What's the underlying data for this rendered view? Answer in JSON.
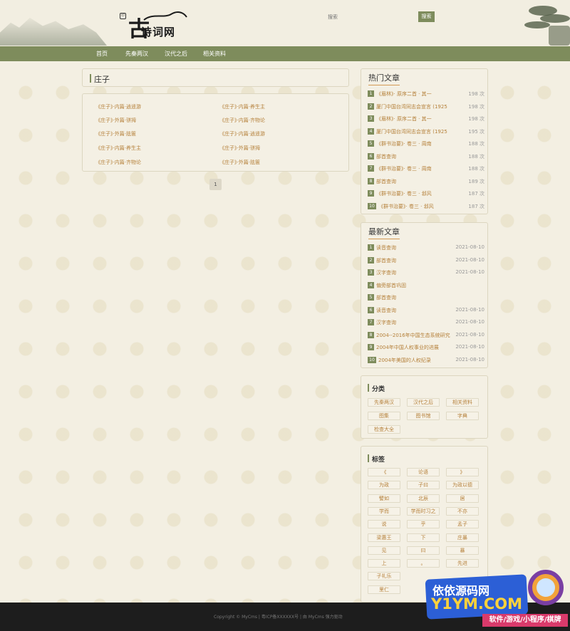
{
  "header": {
    "logo_big": "古",
    "logo_small": "诗词网",
    "seal": "印",
    "search_placeholder": "搜索",
    "search_button": "搜索"
  },
  "nav": [
    "首页",
    "先秦两汉",
    "汉代之后",
    "相关资料"
  ],
  "main": {
    "title": "庄子",
    "items": [
      "《庄子》·内篇·逍遥游",
      "《庄子》·内篇·养生主",
      "《庄子》·外篇·骈拇",
      "《庄子》·内篇·齐物论",
      "《庄子》·外篇·胠箧",
      "《庄子》·内篇·逍遥游",
      "《庄子》·内篇·养生主",
      "《庄子》·外篇·骈拇",
      "《庄子》·内篇·齐物论",
      "《庄子》·外篇·胠箧"
    ],
    "page": "1"
  },
  "hot": {
    "title": "热门文章",
    "rows": [
      {
        "n": "1",
        "t": "《眉林》· 原序二首 · 其一",
        "v": "198 次"
      },
      {
        "n": "2",
        "t": "厦门中国台湾同志会宣言 (1925",
        "v": "198 次"
      },
      {
        "n": "3",
        "t": "《眉林》· 原序二首 · 其一",
        "v": "198 次"
      },
      {
        "n": "4",
        "t": "厦门中国台湾同志会宣言 (1925",
        "v": "195 次"
      },
      {
        "n": "5",
        "t": "《群书治要》· 卷三 · 周南",
        "v": "188 次"
      },
      {
        "n": "6",
        "t": "部首查询",
        "v": "188 次"
      },
      {
        "n": "7",
        "t": "《群书治要》· 卷三 · 周南",
        "v": "188 次"
      },
      {
        "n": "8",
        "t": "部首查询",
        "v": "189 次"
      },
      {
        "n": "9",
        "t": "《群书治要》· 卷三 · 邶风",
        "v": "187 次"
      },
      {
        "n": "10",
        "t": "《群书治要》· 卷三 · 邶风",
        "v": "187 次"
      }
    ]
  },
  "latest": {
    "title": "最新文章",
    "rows": [
      {
        "n": "1",
        "t": "读音查询",
        "v": "2021-08-10"
      },
      {
        "n": "2",
        "t": "部首查询",
        "v": "2021-08-10"
      },
      {
        "n": "3",
        "t": "汉字查询",
        "v": "2021-08-10"
      },
      {
        "n": "4",
        "t": "偏旁部首巩固",
        "v": ""
      },
      {
        "n": "5",
        "t": "部首查询",
        "v": ""
      },
      {
        "n": "6",
        "t": "读音查询",
        "v": "2021-08-10"
      },
      {
        "n": "7",
        "t": "汉字查询",
        "v": "2021-08-10"
      },
      {
        "n": "8",
        "t": "2004--2016年中国生态系统研究",
        "v": "2021-08-10"
      },
      {
        "n": "9",
        "t": "2004年中国人权事业的进展",
        "v": "2021-08-10"
      },
      {
        "n": "10",
        "t": "2004年美国的人权纪录",
        "v": "2021-08-10"
      }
    ]
  },
  "categories": {
    "title": "分类",
    "items": [
      "先秦两汉",
      "汉代之后",
      "相关资料",
      "图集",
      "图书馆",
      "字典",
      "检查大全"
    ]
  },
  "tags": {
    "title": "标签",
    "items": [
      "《",
      "论语",
      "》",
      "为政",
      "子曰",
      "为政以德",
      "譬如",
      "北辰",
      "居",
      "学而",
      "学而时习之",
      "不亦",
      "说",
      "乎",
      "孟子",
      "梁惠王",
      "下",
      "庄暴",
      "见",
      "曰",
      "暴",
      "上",
      "。",
      "先进",
      "子礼乐",
      "",
      "",
      "里仁",
      "",
      ""
    ]
  },
  "footer": {
    "text": "Copyright © MyCms   |   粤ICP备XXXXXX号   |   由 MyCms 强力驱动"
  },
  "watermark": {
    "cn": "依依源码网",
    "en": "Y1YM.COM",
    "sub": "软件/游戏/小程序/棋牌"
  }
}
